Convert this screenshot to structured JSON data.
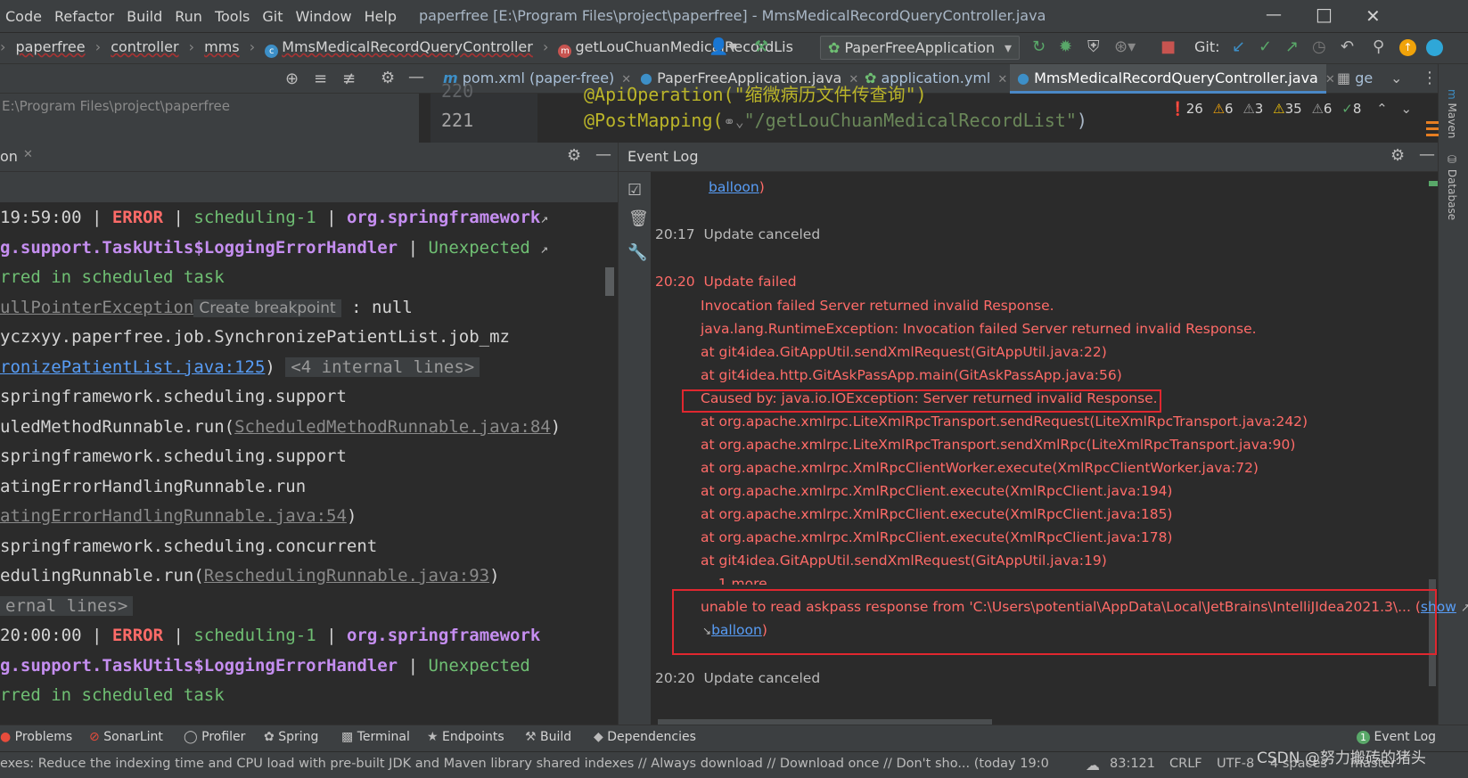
{
  "menu": [
    "Code",
    "Refactor",
    "Build",
    "Run",
    "Tools",
    "Git",
    "Window",
    "Help"
  ],
  "window_title": "paperfree [E:\\Program Files\\project\\paperfree] - MmsMedicalRecordQueryController.java",
  "breadcrumbs": [
    "paperfree",
    "controller",
    "mms",
    "MmsMedicalRecordQueryController",
    "getLouChuanMedicalRecordLis"
  ],
  "run_config": "PaperFreeApplication",
  "git_label": "Git:",
  "editor_tabs": [
    "pom.xml (paper-free)",
    "PaperFreeApplication.java",
    "application.yml",
    "MmsMedicalRecordQueryController.java",
    "ge"
  ],
  "left_path": "E:\\Program Files\\project\\paperfree",
  "editor": {
    "line_prev_no": "220",
    "line_prev": "@ApiOperation(\"缩微病历文件传查询\")",
    "line_no": "221",
    "line_anno": "@PostMapping(",
    "line_str": "\"/getLouChuanMedicalRecordList\"",
    "line_end": ")"
  },
  "inspections": {
    "errors": "26",
    "warnings": "6",
    "weak": "3",
    "typos": "35",
    "w2": "6",
    "ok": "8"
  },
  "left_panel_title": "on",
  "console": {
    "l1_time": "19:59:00",
    "l1_level": "ERROR",
    "l1_thread": "scheduling-1",
    "l1_logger": "org.springframework",
    "l2": "g.support.TaskUtils$LoggingErrorHandler",
    "l2_msg": "Unexpected",
    "l3": "rred in scheduled task",
    "l4_ex": "ullPointerException",
    "l4_hint": "Create breakpoint",
    "l4_rest": " : null",
    "l5": "yczxyy.paperfree.job.SynchronizePatientList.job_mz",
    "l6_link": "ronizePatientList.java:125",
    "l6_rest": ")",
    "l6_inl": "<4 internal lines>",
    "l7": "springframework.scheduling.support",
    "l8_a": "uledMethodRunnable.run(",
    "l8_link": "ScheduledMethodRunnable.java:84",
    "l8_b": ")",
    "l9": "springframework.scheduling.support",
    "l10": "atingErrorHandlingRunnable.run",
    "l11_link": "atingErrorHandlingRunnable.java:54",
    "l11_b": ")",
    "l12": "springframework.scheduling.concurrent",
    "l13_a": "edulingRunnable.run(",
    "l13_link": "ReschedulingRunnable.java:93",
    "l13_b": ")",
    "l14": "ernal lines>",
    "l15_time": "20:00:00",
    "l15_level": "ERROR",
    "l15_thread": "scheduling-1",
    "l15_logger": "org.springframework",
    "l16": "g.support.TaskUtils$LoggingErrorHandler",
    "l16_msg": "Unexpected",
    "l17": "rred in scheduled task"
  },
  "event_log": {
    "title": "Event Log",
    "balloon_top": "balloon",
    "e1_time": "20:17",
    "e1_msg": "Update canceled",
    "e2_time": "20:20",
    "e2_msg": "Update failed",
    "trace": [
      "Invocation failed Server returned invalid Response.",
      "java.lang.RuntimeException: Invocation failed Server returned invalid Response.",
      "at git4idea.GitAppUtil.sendXmlRequest(GitAppUtil.java:22)",
      "at git4idea.http.GitAskPassApp.main(GitAskPassApp.java:56)",
      "Caused by: java.io.IOException: Server returned invalid Response.",
      "at org.apache.xmlrpc.LiteXmlRpcTransport.sendRequest(LiteXmlRpcTransport.java:242)",
      "at org.apache.xmlrpc.LiteXmlRpcTransport.sendXmlRpc(LiteXmlRpcTransport.java:90)",
      "at org.apache.xmlrpc.XmlRpcClientWorker.execute(XmlRpcClientWorker.java:72)",
      "at org.apache.xmlrpc.XmlRpcClient.execute(XmlRpcClient.java:194)",
      "at org.apache.xmlrpc.XmlRpcClient.execute(XmlRpcClient.java:185)",
      "at org.apache.xmlrpc.XmlRpcClient.execute(XmlRpcClient.java:178)",
      "at git4idea.GitAppUtil.sendXmlRequest(GitAppUtil.java:19)"
    ],
    "more": "... 1 more",
    "askpass": "unable to read askpass response from 'C:\\Users\\potential\\AppData\\Local\\JetBrains\\IntelliJIdea2021.3\\... (",
    "show": "show",
    "balloon": "balloon",
    "e3_time": "20:20",
    "e3_msg": "Update canceled"
  },
  "bottom_tabs": [
    "Problems",
    "SonarLint",
    "Profiler",
    "Spring",
    "Terminal",
    "Endpoints",
    "Build",
    "Dependencies"
  ],
  "event_log_tab": "Event Log",
  "event_log_badge": "1",
  "status": {
    "message": "exes: Reduce the indexing time and CPU load with pre-built JDK and Maven library shared indexes // Always download // Download once // Don't sho... (today 19:0",
    "position": "83:121",
    "line_sep": "CRLF",
    "encoding": "UTF-8",
    "indent": "4 spaces",
    "branch": "master"
  },
  "side_labels": [
    "Maven",
    "Database"
  ],
  "watermark": "CSDN @努力搬砖的猪头"
}
